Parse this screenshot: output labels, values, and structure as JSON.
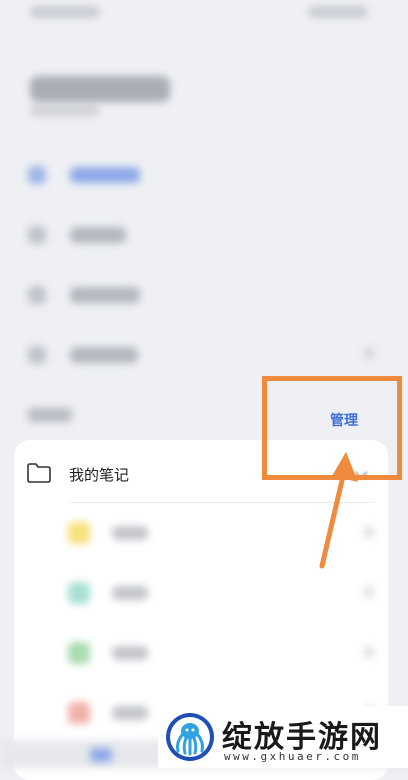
{
  "notes_section": {
    "folder_label": "我的笔记",
    "manage_label": "管理"
  },
  "sub_items": [
    {
      "color": "#f6e27a"
    },
    {
      "color": "#a8e0d6"
    },
    {
      "color": "#a9dcae"
    },
    {
      "color": "#f2b0a8"
    }
  ],
  "watermark": {
    "name": "绽放手游网",
    "url": "www.gxhuaer.com"
  },
  "colors": {
    "accent": "#3f6fd6",
    "highlight": "#f08a3c"
  }
}
